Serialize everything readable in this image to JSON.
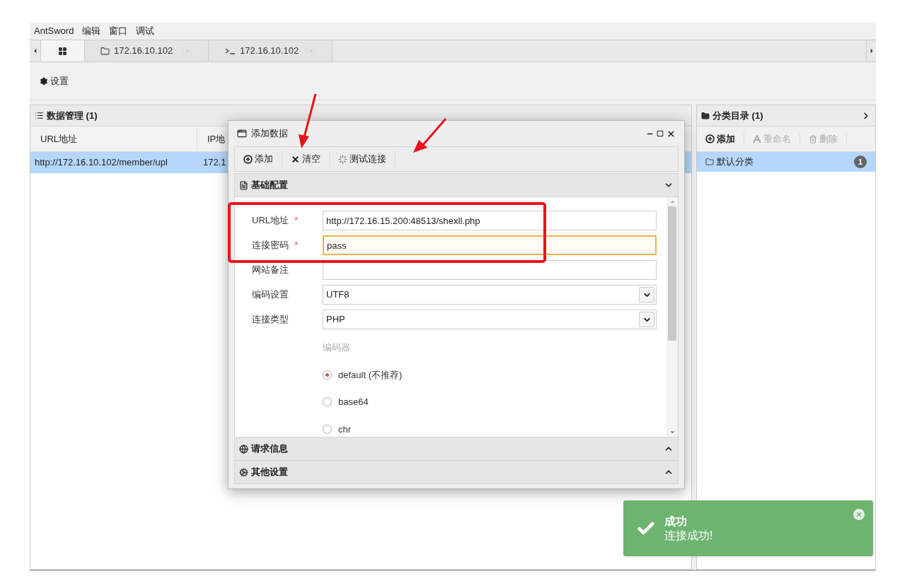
{
  "menu": [
    "AntSword",
    "编辑",
    "窗口",
    "调试"
  ],
  "tabs": [
    {
      "kind": "home",
      "selected": true
    },
    {
      "kind": "files",
      "label": "172.16.10.102",
      "selected": false
    },
    {
      "kind": "terminal",
      "label": "172.16.10.102",
      "selected": false
    }
  ],
  "toolbar": {
    "settings": "设置"
  },
  "data_panel": {
    "title": "数据管理 (1)",
    "columns": [
      "URL地址",
      "IP地"
    ],
    "rows": [
      {
        "cells": [
          "http://172.16.10.102/member/upl",
          "172.1"
        ],
        "selected": true
      }
    ]
  },
  "category_panel": {
    "title": "分类目录 (1)",
    "buttons": [
      {
        "kind": "add",
        "label": "添加",
        "disabled": false
      },
      {
        "kind": "rename",
        "label": "重命名",
        "disabled": true
      },
      {
        "kind": "delete",
        "label": "删除",
        "disabled": true
      }
    ],
    "categories": [
      {
        "label": "默认分类",
        "count": "1",
        "selected": true
      }
    ]
  },
  "dialog": {
    "title": "添加数据",
    "buttons": [
      {
        "kind": "add",
        "label": "添加"
      },
      {
        "kind": "clear",
        "label": "清空"
      },
      {
        "kind": "test",
        "label": "测试连接"
      }
    ],
    "sections": [
      {
        "kind": "basic",
        "title": "基础配置",
        "expanded": true
      },
      {
        "kind": "request",
        "title": "请求信息",
        "expanded": false
      },
      {
        "kind": "other",
        "title": "其他设置",
        "expanded": false
      }
    ],
    "fields": [
      {
        "kind": "text",
        "label": "URL地址",
        "required_mark": "*",
        "value": "http://172.16.15.200:48513/shexll.php",
        "focused": false
      },
      {
        "kind": "text",
        "label": "连接密码",
        "required_mark": "*",
        "value": "pass",
        "focused": true
      },
      {
        "kind": "text",
        "label": "网站备注",
        "focused": false
      },
      {
        "kind": "select",
        "label": "编码设置",
        "value": "UTF8"
      },
      {
        "kind": "select",
        "label": "连接类型",
        "value": "PHP"
      }
    ],
    "encoder": {
      "label": "编码器",
      "options": [
        {
          "label": "default (不推荐)",
          "selected": true
        },
        {
          "label": "base64",
          "selected": false
        },
        {
          "label": "chr",
          "selected": false
        }
      ]
    }
  },
  "toast": {
    "title": "成功",
    "message": "连接成功!"
  }
}
